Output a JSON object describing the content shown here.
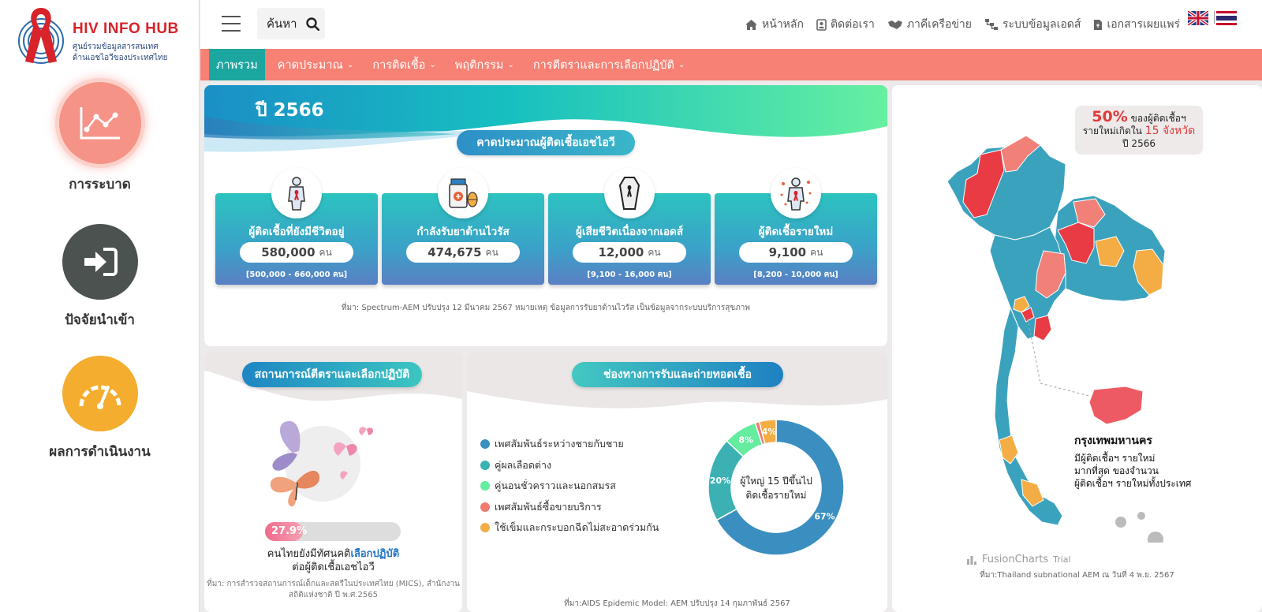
{
  "logo": {
    "title": "HIV INFO HUB",
    "subtitle_line1": "ศูนย์รวมข้อมูลสารสนเทศ",
    "subtitle_line2": "ด้านเอชไอวีของประเทศไทย"
  },
  "sidebar": {
    "items": [
      {
        "label": "การระบาด",
        "icon": "chart-line-icon",
        "color": "#f59387"
      },
      {
        "label": "ปัจจัยนำเข้า",
        "icon": "sign-in-icon",
        "color": "#4b5250"
      },
      {
        "label": "ผลการดำเนินงาน",
        "icon": "speedometer-icon",
        "color": "#f4ad2e"
      }
    ]
  },
  "topbar": {
    "search_placeholder": "ค้นหา",
    "nav": [
      {
        "label": "หน้าหลัก",
        "icon": "home-icon"
      },
      {
        "label": "ติดต่อเรา",
        "icon": "contact-icon"
      },
      {
        "label": "ภาคีเครือข่าย",
        "icon": "handshake-icon"
      },
      {
        "label": "ระบบข้อมูลเอดส์",
        "icon": "sitemap-icon"
      },
      {
        "label": "เอกสารเผยแพร่",
        "icon": "document-icon"
      }
    ]
  },
  "menu": [
    {
      "label": "ภาพรวม",
      "active": true
    },
    {
      "label": "คาดประมาณ",
      "dropdown": true
    },
    {
      "label": "การติดเชื้อ",
      "dropdown": true
    },
    {
      "label": "พฤติกรรม",
      "dropdown": true
    },
    {
      "label": "การตีตราและการเลือกปฏิบัติ",
      "dropdown": true
    }
  ],
  "estimate": {
    "year": "ปี 2566",
    "heading": "คาดประมาณผู้ติดเชื้อเอชไอวี",
    "cards": [
      {
        "title": "ผู้ติดเชื้อที่ยังมีชีวิตอยู่",
        "value": "580,000",
        "unit": "คน",
        "range": "[500,000 - 660,000 คน]",
        "icon": "person-ribbon-icon"
      },
      {
        "title": "กำลังรับยาต้านไวรัส",
        "value": "474,675",
        "unit": "คน",
        "range": "",
        "icon": "medicine-icon"
      },
      {
        "title": "ผู้เสียชีวิตเนื่องจากเอดส์",
        "value": "12,000",
        "unit": "คน",
        "range": "[9,100 - 16,000 คน]",
        "icon": "coffin-icon"
      },
      {
        "title": "ผู้ติดเชื้อรายใหม่",
        "value": "9,100",
        "unit": "คน",
        "range": "[8,200 - 10,000 คน]",
        "icon": "person-virus-icon"
      }
    ],
    "source": "ที่มา: Spectrum-AEM ปรับปรุง 12 มีนาคม 2567 หมายเหตุ ข้อมูลการรับยาต้านไวรัส เป็นข้อมูลจากระบบบริการสุขภาพ"
  },
  "stigma": {
    "heading": "สถานการณ์ตีตราและเลือกปฏิบัติ",
    "percent_label": "27.9%",
    "percent": 27.9,
    "text_line1_pre": "คนไทยยังมีทัศนคติ",
    "text_line1_hl": "เลือกปฏิบัติ",
    "text_line2": "ต่อผู้ติดเชื้อเอชไอวี",
    "source_line1": "ที่มา: การสำรวจสถานการณ์เด็กและสตรีในประเทศไทย (MICS), สำนักงาน",
    "source_line2": "สถิติแห่งชาติ ปี พ.ศ.2565"
  },
  "routes": {
    "heading": "ช่องทางการรับและถ่ายทอดเชื้อ",
    "center_line1": "ผู้ใหญ่ 15 ปีขึ้นไป",
    "center_line2": "ติดเชื้อรายใหม่",
    "source": "ที่มา:AIDS Epidemic Model: AEM ปรับปรุง 14 กุมภาพันธ์ 2567"
  },
  "chart_data": {
    "type": "pie",
    "categories": [
      "เพศสัมพันธ์ระหว่างชายกับชาย",
      "คู่ผลเลือดต่าง",
      "คู่นอนชั่วคราวและนอกสมรส",
      "เพศสัมพันธ์ซื้อขายบริการ",
      "ใช้เข็มและกระบอกฉีดไม่สะอาดร่วมกัน"
    ],
    "values": [
      67,
      20,
      8,
      1,
      4
    ],
    "labels": [
      "67%",
      "20%",
      "8%",
      "",
      "4%"
    ],
    "colors": [
      "#3b8fc0",
      "#3bb1b3",
      "#64ec9f",
      "#ef7b6f",
      "#f2ad43"
    ],
    "legend_position": "left"
  },
  "map": {
    "info_percent": "50%",
    "info_text1": "ของผู้ติดเชื้อฯ",
    "info_text2_pre": "รายใหม่เกิดใน",
    "info_provinces": "15 จังหวัด",
    "info_year": "ปี 2566",
    "bkk_title": "กรุงเทพมหานคร",
    "bkk_line1": "มีผู้ติดเชื้อฯ รายใหม่",
    "bkk_line2": "มากที่สุด ของจำนวน",
    "bkk_line3": "ผู้ติดเชื้อฯ รายใหม่ทั้งประเทศ",
    "fusion": "FusionCharts",
    "fusion_trial": "Trial",
    "source": "ที่มา:Thailand subnational AEM ณ วันที่ 4 พ.ย. 2567"
  },
  "colors": {
    "accent_coral": "#f68174",
    "accent_teal": "#1ba7a0",
    "map_base": "#3ba2bd",
    "map_red": "#e83b43",
    "map_salmon": "#f08078",
    "map_orange": "#f4ad45"
  }
}
